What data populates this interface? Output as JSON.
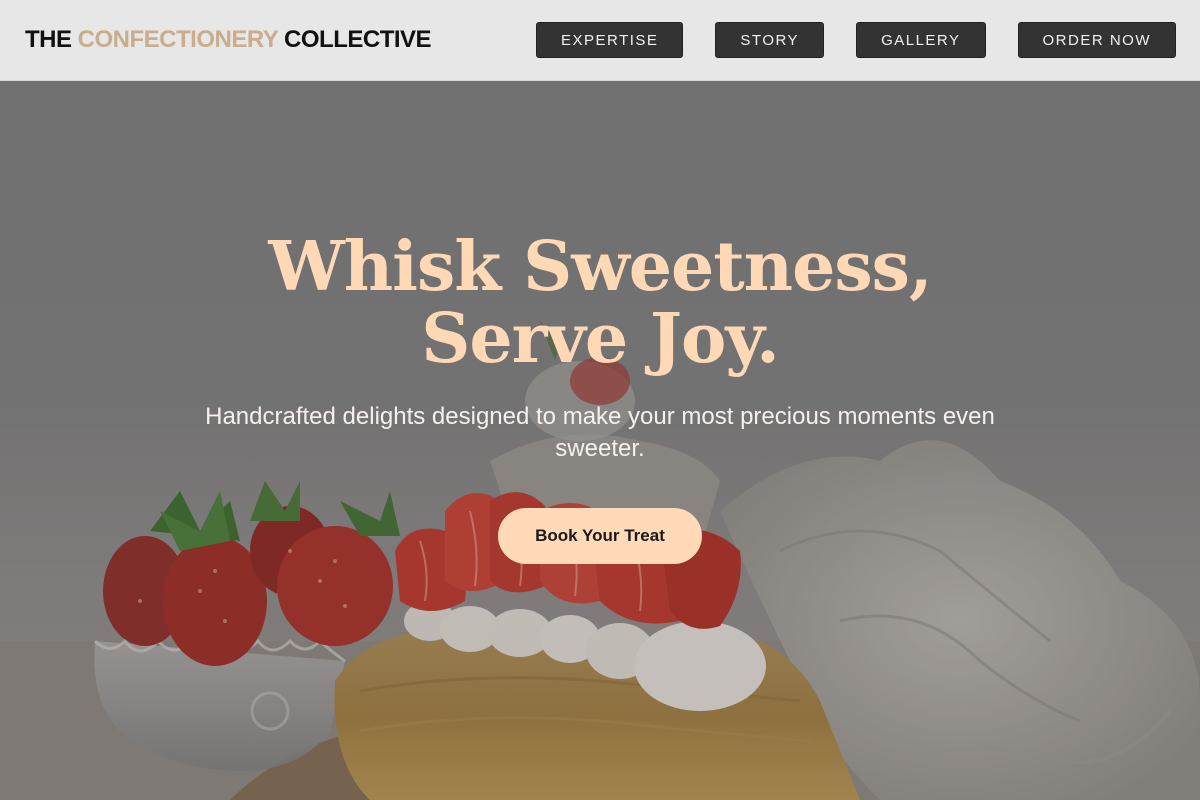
{
  "header": {
    "brand": {
      "prefix": "THE ",
      "accent": "CONFECTIONERY",
      "suffix": " COLLECTIVE"
    },
    "nav": [
      {
        "label": "EXPERTISE"
      },
      {
        "label": "STORY"
      },
      {
        "label": "GALLERY"
      },
      {
        "label": "ORDER NOW"
      }
    ]
  },
  "hero": {
    "headline_line1": "Whisk Sweetness,",
    "headline_line2": "Serve Joy.",
    "subheading": "Handcrafted delights designed to make your most precious moments even sweeter.",
    "cta_label": "Book Your Treat"
  },
  "colors": {
    "brand_accent": "#c9ad8c",
    "headline": "#ffd8b6",
    "cta_background": "#ffd9b8",
    "nav_button": "#333333",
    "header_background": "#e7e7e7"
  }
}
